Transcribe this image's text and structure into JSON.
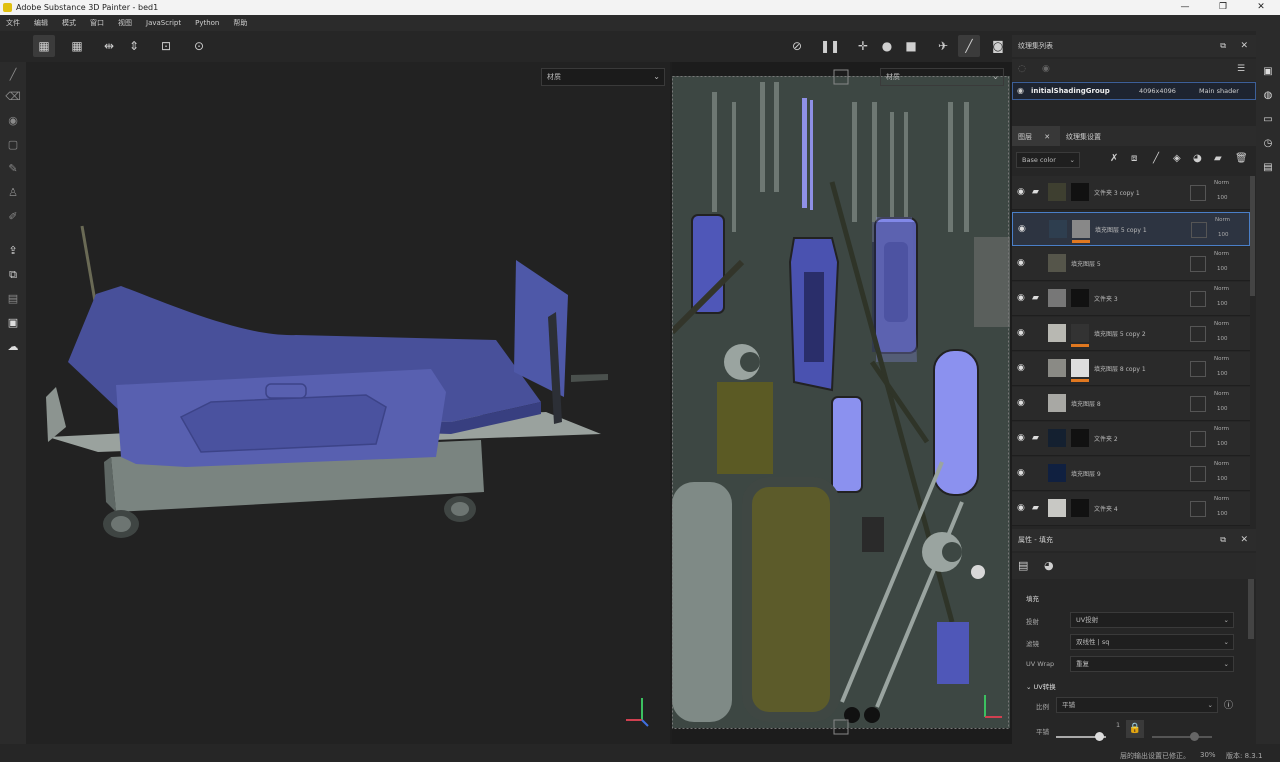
{
  "window": {
    "title": "Adobe Substance 3D Painter - bed1",
    "minimize": "—",
    "maximize": "❐",
    "close": "✕"
  },
  "menu": [
    "文件",
    "编辑",
    "模式",
    "窗口",
    "视图",
    "JavaScript",
    "Python",
    "帮助"
  ],
  "viewport3d": {
    "mode_select": "材质"
  },
  "viewport2d": {
    "mode_select": "材质"
  },
  "texture_set_panel": {
    "title": "纹理集列表",
    "item_name": "initialShadingGroup",
    "item_size": "4096x4096",
    "item_shader": "Main shader"
  },
  "layers_panel": {
    "tab_layers": "图层",
    "tab_settings": "纹理集设置",
    "channel_select": "Base color",
    "layers": [
      {
        "name": "文件夹 3 copy 1",
        "folder": true,
        "blend": "Norm",
        "opacity": "100"
      },
      {
        "name": "填充图层 5 copy 1",
        "folder": false,
        "blend": "Norm",
        "opacity": "100"
      },
      {
        "name": "填充图层 5",
        "folder": false,
        "blend": "Norm",
        "opacity": "100"
      },
      {
        "name": "文件夹 3",
        "folder": true,
        "blend": "Norm",
        "opacity": "100"
      },
      {
        "name": "填充图层 5 copy 2",
        "folder": false,
        "blend": "Norm",
        "opacity": "100"
      },
      {
        "name": "填充图层 8 copy 1",
        "folder": false,
        "blend": "Norm",
        "opacity": "100"
      },
      {
        "name": "填充图层 8",
        "folder": false,
        "blend": "Norm",
        "opacity": "100"
      },
      {
        "name": "文件夹 2",
        "folder": true,
        "blend": "Norm",
        "opacity": "100"
      },
      {
        "name": "填充图层 9",
        "folder": false,
        "blend": "Norm",
        "opacity": "100"
      },
      {
        "name": "文件夹 4",
        "folder": true,
        "blend": "Norm",
        "opacity": "100"
      }
    ]
  },
  "properties_panel": {
    "title": "属性 - 填充",
    "section_fill": "填充",
    "projection_label": "投射",
    "projection_value": "UV投射",
    "filter_label": "滤镜",
    "filter_value": "双线性 | sq",
    "uvwrap_label": "UV Wrap",
    "uvwrap_value": "重复",
    "uv_transform": "UV转换",
    "scale_label": "比例",
    "scale_value": "平铺",
    "tile_label": "平铺",
    "tile_value": "1"
  },
  "status": {
    "message": "层的输出设置已修正。",
    "zoom": "30%",
    "version": "版本: 8.3.1"
  }
}
